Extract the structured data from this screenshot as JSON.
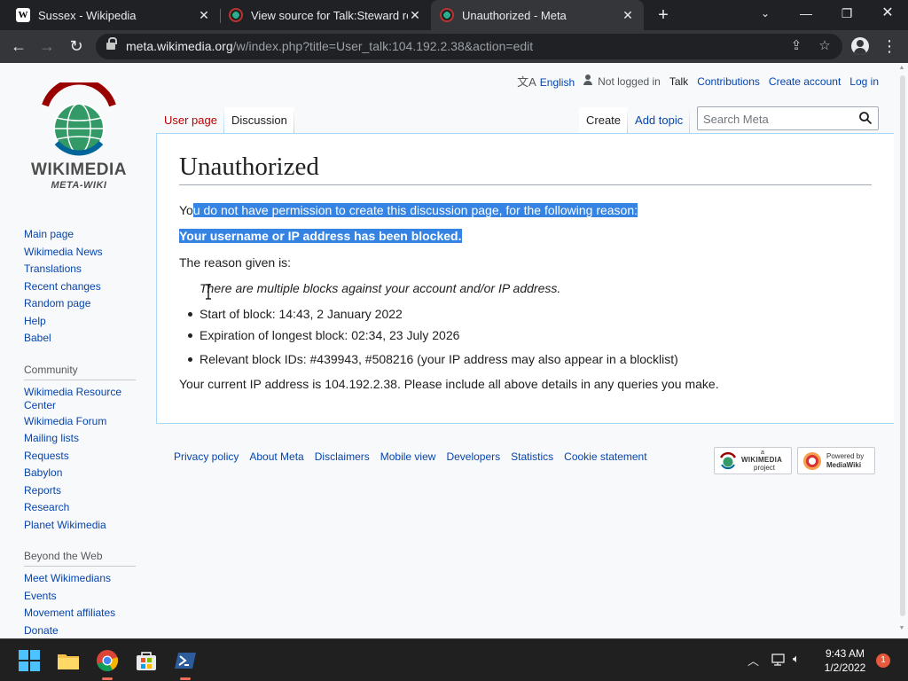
{
  "browser": {
    "tabs": [
      {
        "title": "Sussex - Wikipedia",
        "active": false
      },
      {
        "title": "View source for Talk:Steward requ",
        "active": false
      },
      {
        "title": "Unauthorized - Meta",
        "active": true
      }
    ],
    "url_host": "meta.wikimedia.org",
    "url_rest": "/w/index.php?title=User_talk:104.192.2.38&action=edit"
  },
  "logo": {
    "wordmark": "WIKIMEDIA",
    "subtitle": "META-WIKI"
  },
  "personal_tools": {
    "language": "English",
    "not_logged_in": "Not logged in",
    "talk": "Talk",
    "contributions": "Contributions",
    "create_account": "Create account",
    "log_in": "Log in"
  },
  "page_tabs": {
    "user_page": "User page",
    "discussion": "Discussion",
    "create": "Create",
    "add_topic": "Add topic"
  },
  "search": {
    "placeholder": "Search Meta"
  },
  "sidebar": {
    "main": [
      "Main page",
      "Wikimedia News",
      "Translations",
      "Recent changes",
      "Random page",
      "Help",
      "Babel"
    ],
    "community_heading": "Community",
    "community": [
      "Wikimedia Resource Center",
      "Wikimedia Forum",
      "Mailing lists",
      "Requests",
      "Babylon",
      "Reports",
      "Research",
      "Planet Wikimedia"
    ],
    "beyond_heading": "Beyond the Web",
    "beyond": [
      "Meet Wikimedians",
      "Events",
      "Movement affiliates",
      "Donate"
    ]
  },
  "article": {
    "title": "Unauthorized",
    "intro_prefix": "Yo",
    "intro_selected": "u do not have permission to create this discussion page, for the following reason:",
    "blocked": "Your username or IP address has been blocked.",
    "reason_label": "The reason given is:",
    "reason": "There are multiple blocks against your account and/or IP address.",
    "details": [
      "Start of block: 14:43, 2 January 2022",
      "Expiration of longest block: 02:34, 23 July 2026",
      "Relevant block IDs: #439943, #508216 (your IP address may also appear in a blocklist)"
    ],
    "ip_note": "Your current IP address is 104.192.2.38. Please include all above details in any queries you make."
  },
  "footer": {
    "links": [
      "Privacy policy",
      "About Meta",
      "Disclaimers",
      "Mobile view",
      "Developers",
      "Statistics",
      "Cookie statement"
    ],
    "wikimedia_badge_small": "a",
    "wikimedia_badge_big": "WIKIMEDIA",
    "wikimedia_badge_sub": "project",
    "mediawiki_badge_1": "Powered by",
    "mediawiki_badge_2": "MediaWiki"
  },
  "taskbar": {
    "time": "9:43 AM",
    "date": "1/2/2022",
    "notifications": "1"
  },
  "colors": {
    "link": "#0645ad",
    "new_link": "#ba0000",
    "selection": "#3584e4",
    "chrome_dark": "#202124"
  }
}
